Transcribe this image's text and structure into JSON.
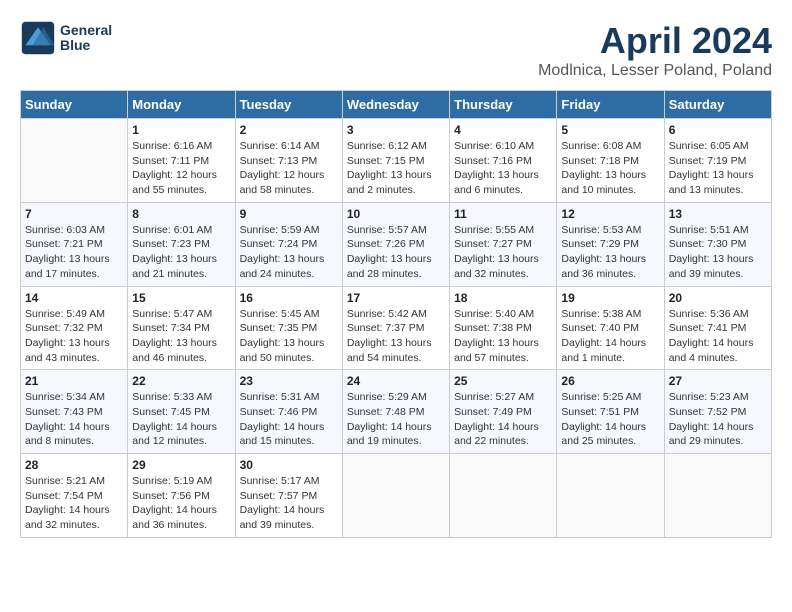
{
  "header": {
    "logo_line1": "General",
    "logo_line2": "Blue",
    "title": "April 2024",
    "subtitle": "Modlnica, Lesser Poland, Poland"
  },
  "days_of_week": [
    "Sunday",
    "Monday",
    "Tuesday",
    "Wednesday",
    "Thursday",
    "Friday",
    "Saturday"
  ],
  "weeks": [
    [
      {
        "day": "",
        "info": ""
      },
      {
        "day": "1",
        "info": "Sunrise: 6:16 AM\nSunset: 7:11 PM\nDaylight: 12 hours\nand 55 minutes."
      },
      {
        "day": "2",
        "info": "Sunrise: 6:14 AM\nSunset: 7:13 PM\nDaylight: 12 hours\nand 58 minutes."
      },
      {
        "day": "3",
        "info": "Sunrise: 6:12 AM\nSunset: 7:15 PM\nDaylight: 13 hours\nand 2 minutes."
      },
      {
        "day": "4",
        "info": "Sunrise: 6:10 AM\nSunset: 7:16 PM\nDaylight: 13 hours\nand 6 minutes."
      },
      {
        "day": "5",
        "info": "Sunrise: 6:08 AM\nSunset: 7:18 PM\nDaylight: 13 hours\nand 10 minutes."
      },
      {
        "day": "6",
        "info": "Sunrise: 6:05 AM\nSunset: 7:19 PM\nDaylight: 13 hours\nand 13 minutes."
      }
    ],
    [
      {
        "day": "7",
        "info": "Sunrise: 6:03 AM\nSunset: 7:21 PM\nDaylight: 13 hours\nand 17 minutes."
      },
      {
        "day": "8",
        "info": "Sunrise: 6:01 AM\nSunset: 7:23 PM\nDaylight: 13 hours\nand 21 minutes."
      },
      {
        "day": "9",
        "info": "Sunrise: 5:59 AM\nSunset: 7:24 PM\nDaylight: 13 hours\nand 24 minutes."
      },
      {
        "day": "10",
        "info": "Sunrise: 5:57 AM\nSunset: 7:26 PM\nDaylight: 13 hours\nand 28 minutes."
      },
      {
        "day": "11",
        "info": "Sunrise: 5:55 AM\nSunset: 7:27 PM\nDaylight: 13 hours\nand 32 minutes."
      },
      {
        "day": "12",
        "info": "Sunrise: 5:53 AM\nSunset: 7:29 PM\nDaylight: 13 hours\nand 36 minutes."
      },
      {
        "day": "13",
        "info": "Sunrise: 5:51 AM\nSunset: 7:30 PM\nDaylight: 13 hours\nand 39 minutes."
      }
    ],
    [
      {
        "day": "14",
        "info": "Sunrise: 5:49 AM\nSunset: 7:32 PM\nDaylight: 13 hours\nand 43 minutes."
      },
      {
        "day": "15",
        "info": "Sunrise: 5:47 AM\nSunset: 7:34 PM\nDaylight: 13 hours\nand 46 minutes."
      },
      {
        "day": "16",
        "info": "Sunrise: 5:45 AM\nSunset: 7:35 PM\nDaylight: 13 hours\nand 50 minutes."
      },
      {
        "day": "17",
        "info": "Sunrise: 5:42 AM\nSunset: 7:37 PM\nDaylight: 13 hours\nand 54 minutes."
      },
      {
        "day": "18",
        "info": "Sunrise: 5:40 AM\nSunset: 7:38 PM\nDaylight: 13 hours\nand 57 minutes."
      },
      {
        "day": "19",
        "info": "Sunrise: 5:38 AM\nSunset: 7:40 PM\nDaylight: 14 hours\nand 1 minute."
      },
      {
        "day": "20",
        "info": "Sunrise: 5:36 AM\nSunset: 7:41 PM\nDaylight: 14 hours\nand 4 minutes."
      }
    ],
    [
      {
        "day": "21",
        "info": "Sunrise: 5:34 AM\nSunset: 7:43 PM\nDaylight: 14 hours\nand 8 minutes."
      },
      {
        "day": "22",
        "info": "Sunrise: 5:33 AM\nSunset: 7:45 PM\nDaylight: 14 hours\nand 12 minutes."
      },
      {
        "day": "23",
        "info": "Sunrise: 5:31 AM\nSunset: 7:46 PM\nDaylight: 14 hours\nand 15 minutes."
      },
      {
        "day": "24",
        "info": "Sunrise: 5:29 AM\nSunset: 7:48 PM\nDaylight: 14 hours\nand 19 minutes."
      },
      {
        "day": "25",
        "info": "Sunrise: 5:27 AM\nSunset: 7:49 PM\nDaylight: 14 hours\nand 22 minutes."
      },
      {
        "day": "26",
        "info": "Sunrise: 5:25 AM\nSunset: 7:51 PM\nDaylight: 14 hours\nand 25 minutes."
      },
      {
        "day": "27",
        "info": "Sunrise: 5:23 AM\nSunset: 7:52 PM\nDaylight: 14 hours\nand 29 minutes."
      }
    ],
    [
      {
        "day": "28",
        "info": "Sunrise: 5:21 AM\nSunset: 7:54 PM\nDaylight: 14 hours\nand 32 minutes."
      },
      {
        "day": "29",
        "info": "Sunrise: 5:19 AM\nSunset: 7:56 PM\nDaylight: 14 hours\nand 36 minutes."
      },
      {
        "day": "30",
        "info": "Sunrise: 5:17 AM\nSunset: 7:57 PM\nDaylight: 14 hours\nand 39 minutes."
      },
      {
        "day": "",
        "info": ""
      },
      {
        "day": "",
        "info": ""
      },
      {
        "day": "",
        "info": ""
      },
      {
        "day": "",
        "info": ""
      }
    ]
  ]
}
